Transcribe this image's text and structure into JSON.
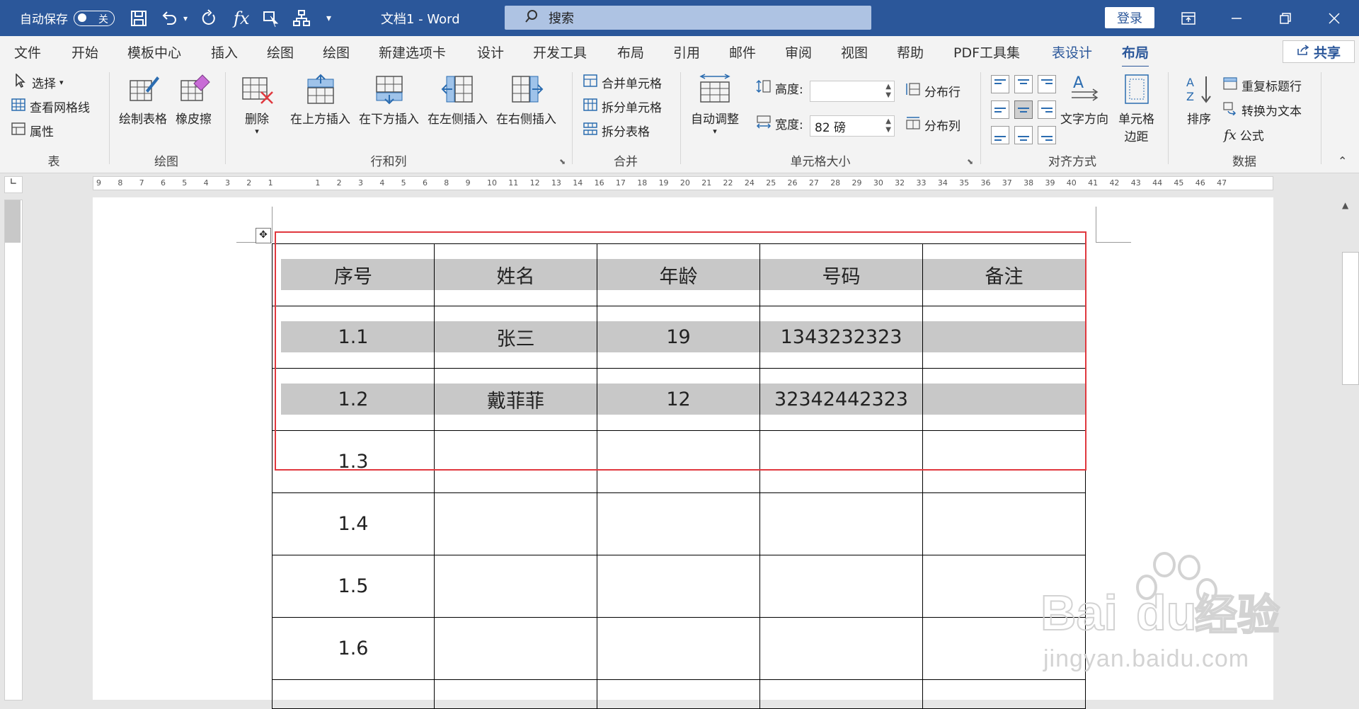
{
  "titlebar": {
    "autosave_label": "自动保存",
    "autosave_state": "关",
    "doc_title": "文档1  -  Word",
    "search_placeholder": "搜索",
    "login_label": "登录"
  },
  "tabs": [
    {
      "label": "文件"
    },
    {
      "label": "开始"
    },
    {
      "label": "模板中心"
    },
    {
      "label": "插入"
    },
    {
      "label": "绘图"
    },
    {
      "label": "绘图"
    },
    {
      "label": "新建选项卡"
    },
    {
      "label": "设计"
    },
    {
      "label": "开发工具"
    },
    {
      "label": "布局"
    },
    {
      "label": "引用"
    },
    {
      "label": "邮件"
    },
    {
      "label": "审阅"
    },
    {
      "label": "视图"
    },
    {
      "label": "帮助"
    },
    {
      "label": "PDF工具集"
    },
    {
      "label": "表设计"
    },
    {
      "label": "布局"
    }
  ],
  "share_label": "共享",
  "ribbon": {
    "table": {
      "select": "选择",
      "gridlines": "查看网格线",
      "properties": "属性",
      "group": "表"
    },
    "draw": {
      "draw_table": "绘制表格",
      "eraser": "橡皮擦",
      "group": "绘图"
    },
    "rows_cols": {
      "delete": "删除",
      "insert_above": "在上方插入",
      "insert_below": "在下方插入",
      "insert_left": "在左侧插入",
      "insert_right": "在右侧插入",
      "group": "行和列"
    },
    "merge": {
      "merge_cells": "合并单元格",
      "split_cells": "拆分单元格",
      "split_table": "拆分表格",
      "group": "合并"
    },
    "cell_size": {
      "autofit": "自动调整",
      "height_label": "高度:",
      "height_value": "",
      "width_label": "宽度:",
      "width_value": "82 磅",
      "dist_rows": "分布行",
      "dist_cols": "分布列",
      "group": "单元格大小"
    },
    "alignment": {
      "text_direction": "文字方向",
      "cell_margins_1": "单元格",
      "cell_margins_2": "边距",
      "group": "对齐方式"
    },
    "data": {
      "sort": "排序",
      "repeat_header": "重复标题行",
      "convert_text": "转换为文本",
      "formula": "公式",
      "group": "数据"
    }
  },
  "ruler_ticks": [
    "9",
    "8",
    "7",
    "6",
    "5",
    "4",
    "3",
    "2",
    "1",
    "1",
    "2",
    "3",
    "4",
    "5",
    "6",
    "8",
    "9",
    "10",
    "11",
    "12",
    "13",
    "14",
    "16",
    "17",
    "18",
    "19",
    "20",
    "21",
    "22",
    "24",
    "25",
    "26",
    "27",
    "28",
    "29",
    "30",
    "32",
    "33",
    "34",
    "35",
    "36",
    "37",
    "38",
    "39",
    "40",
    "41",
    "42",
    "43",
    "44",
    "45",
    "46",
    "47"
  ],
  "table": {
    "rows": [
      [
        "序号",
        "姓名",
        "年龄",
        "号码",
        "备注"
      ],
      [
        "1.1",
        "张三",
        "19",
        "1343232323",
        ""
      ],
      [
        "1.2",
        "戴菲菲",
        "12",
        "32342442323",
        ""
      ],
      [
        "1.3",
        "",
        "",
        "",
        ""
      ],
      [
        "1.4",
        "",
        "",
        "",
        ""
      ],
      [
        "1.5",
        "",
        "",
        "",
        ""
      ],
      [
        "1.6",
        "",
        "",
        "",
        ""
      ],
      [
        "",
        "",
        "",
        "",
        ""
      ]
    ],
    "shaded_rows": [
      0,
      1,
      2
    ]
  },
  "watermark": {
    "brand": "Bai du 经验",
    "url": "jingyan.baidu.com"
  },
  "colors": {
    "brand_blue": "#2b579a",
    "highlight_red": "#e0383e",
    "cell_shading": "#c8c8c8"
  }
}
